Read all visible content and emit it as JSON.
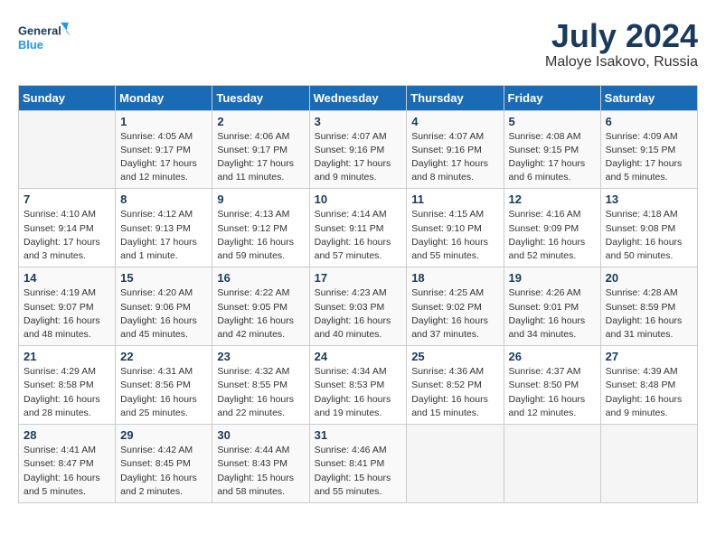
{
  "header": {
    "logo_line1": "General",
    "logo_line2": "Blue",
    "month_year": "July 2024",
    "location": "Maloye Isakovo, Russia"
  },
  "days_of_week": [
    "Sunday",
    "Monday",
    "Tuesday",
    "Wednesday",
    "Thursday",
    "Friday",
    "Saturday"
  ],
  "weeks": [
    [
      null,
      {
        "day": "1",
        "sunrise": "4:05 AM",
        "sunset": "9:17 PM",
        "daylight": "17 hours and 12 minutes."
      },
      {
        "day": "2",
        "sunrise": "4:06 AM",
        "sunset": "9:17 PM",
        "daylight": "17 hours and 11 minutes."
      },
      {
        "day": "3",
        "sunrise": "4:07 AM",
        "sunset": "9:16 PM",
        "daylight": "17 hours and 9 minutes."
      },
      {
        "day": "4",
        "sunrise": "4:07 AM",
        "sunset": "9:16 PM",
        "daylight": "17 hours and 8 minutes."
      },
      {
        "day": "5",
        "sunrise": "4:08 AM",
        "sunset": "9:15 PM",
        "daylight": "17 hours and 6 minutes."
      },
      {
        "day": "6",
        "sunrise": "4:09 AM",
        "sunset": "9:15 PM",
        "daylight": "17 hours and 5 minutes."
      }
    ],
    [
      {
        "day": "7",
        "sunrise": "4:10 AM",
        "sunset": "9:14 PM",
        "daylight": "17 hours and 3 minutes."
      },
      {
        "day": "8",
        "sunrise": "4:12 AM",
        "sunset": "9:13 PM",
        "daylight": "17 hours and 1 minute."
      },
      {
        "day": "9",
        "sunrise": "4:13 AM",
        "sunset": "9:12 PM",
        "daylight": "16 hours and 59 minutes."
      },
      {
        "day": "10",
        "sunrise": "4:14 AM",
        "sunset": "9:11 PM",
        "daylight": "16 hours and 57 minutes."
      },
      {
        "day": "11",
        "sunrise": "4:15 AM",
        "sunset": "9:10 PM",
        "daylight": "16 hours and 55 minutes."
      },
      {
        "day": "12",
        "sunrise": "4:16 AM",
        "sunset": "9:09 PM",
        "daylight": "16 hours and 52 minutes."
      },
      {
        "day": "13",
        "sunrise": "4:18 AM",
        "sunset": "9:08 PM",
        "daylight": "16 hours and 50 minutes."
      }
    ],
    [
      {
        "day": "14",
        "sunrise": "4:19 AM",
        "sunset": "9:07 PM",
        "daylight": "16 hours and 48 minutes."
      },
      {
        "day": "15",
        "sunrise": "4:20 AM",
        "sunset": "9:06 PM",
        "daylight": "16 hours and 45 minutes."
      },
      {
        "day": "16",
        "sunrise": "4:22 AM",
        "sunset": "9:05 PM",
        "daylight": "16 hours and 42 minutes."
      },
      {
        "day": "17",
        "sunrise": "4:23 AM",
        "sunset": "9:03 PM",
        "daylight": "16 hours and 40 minutes."
      },
      {
        "day": "18",
        "sunrise": "4:25 AM",
        "sunset": "9:02 PM",
        "daylight": "16 hours and 37 minutes."
      },
      {
        "day": "19",
        "sunrise": "4:26 AM",
        "sunset": "9:01 PM",
        "daylight": "16 hours and 34 minutes."
      },
      {
        "day": "20",
        "sunrise": "4:28 AM",
        "sunset": "8:59 PM",
        "daylight": "16 hours and 31 minutes."
      }
    ],
    [
      {
        "day": "21",
        "sunrise": "4:29 AM",
        "sunset": "8:58 PM",
        "daylight": "16 hours and 28 minutes."
      },
      {
        "day": "22",
        "sunrise": "4:31 AM",
        "sunset": "8:56 PM",
        "daylight": "16 hours and 25 minutes."
      },
      {
        "day": "23",
        "sunrise": "4:32 AM",
        "sunset": "8:55 PM",
        "daylight": "16 hours and 22 minutes."
      },
      {
        "day": "24",
        "sunrise": "4:34 AM",
        "sunset": "8:53 PM",
        "daylight": "16 hours and 19 minutes."
      },
      {
        "day": "25",
        "sunrise": "4:36 AM",
        "sunset": "8:52 PM",
        "daylight": "16 hours and 15 minutes."
      },
      {
        "day": "26",
        "sunrise": "4:37 AM",
        "sunset": "8:50 PM",
        "daylight": "16 hours and 12 minutes."
      },
      {
        "day": "27",
        "sunrise": "4:39 AM",
        "sunset": "8:48 PM",
        "daylight": "16 hours and 9 minutes."
      }
    ],
    [
      {
        "day": "28",
        "sunrise": "4:41 AM",
        "sunset": "8:47 PM",
        "daylight": "16 hours and 5 minutes."
      },
      {
        "day": "29",
        "sunrise": "4:42 AM",
        "sunset": "8:45 PM",
        "daylight": "16 hours and 2 minutes."
      },
      {
        "day": "30",
        "sunrise": "4:44 AM",
        "sunset": "8:43 PM",
        "daylight": "15 hours and 58 minutes."
      },
      {
        "day": "31",
        "sunrise": "4:46 AM",
        "sunset": "8:41 PM",
        "daylight": "15 hours and 55 minutes."
      },
      null,
      null,
      null
    ]
  ]
}
